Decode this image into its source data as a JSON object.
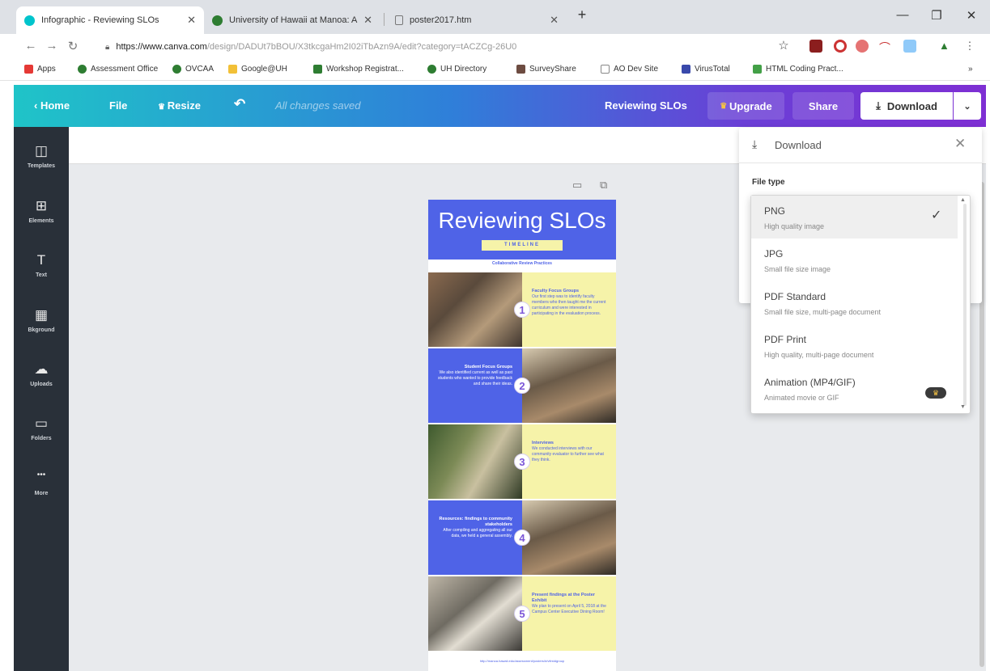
{
  "browser": {
    "tabs": [
      {
        "title": "Infographic - Reviewing SLOs",
        "active": true,
        "color": "#00c4cc"
      },
      {
        "title": "University of Hawaii at Manoa: A",
        "active": false,
        "color": "#2e7d32"
      },
      {
        "title": "poster2017.htm",
        "active": false,
        "color": "#9e9e9e"
      }
    ],
    "new_tab": "+",
    "url_host": "https://www.canva.com",
    "url_path": "/design/DADUt7bBOU/X3tkcgaHm2I02iTbAzn9A/edit?category=tACZCg-26U0",
    "bookmarks": [
      {
        "label": "Apps",
        "color": "#e53935"
      },
      {
        "label": "Assessment Office",
        "color": "#2e7d32"
      },
      {
        "label": "OVCAA",
        "color": "#2e7d32"
      },
      {
        "label": "Google@UH",
        "color": "#f2c037"
      },
      {
        "label": "Workshop Registrat...",
        "color": "#2e7d32"
      },
      {
        "label": "UH Directory",
        "color": "#2e7d32"
      },
      {
        "label": "SurveyShare",
        "color": "#6d4c41"
      },
      {
        "label": "AO Dev Site",
        "color": "#9e9e9e"
      },
      {
        "label": "VirusTotal",
        "color": "#3949ab"
      },
      {
        "label": "HTML Coding Pract...",
        "color": "#43a047"
      }
    ],
    "bookmarks_more": "»"
  },
  "toolbar": {
    "home": "Home",
    "file": "File",
    "resize": "Resize",
    "saved_status": "All changes saved",
    "design_title": "Reviewing SLOs",
    "upgrade": "Upgrade",
    "share": "Share",
    "download": "Download"
  },
  "sidebar": {
    "items": [
      {
        "label": "Templates",
        "icon": "templates-icon",
        "glyph": "◫"
      },
      {
        "label": "Elements",
        "icon": "elements-icon",
        "glyph": "⊞"
      },
      {
        "label": "Text",
        "icon": "text-icon",
        "glyph": "T"
      },
      {
        "label": "Bkground",
        "icon": "background-icon",
        "glyph": "▦"
      },
      {
        "label": "Uploads",
        "icon": "upload-cloud-icon",
        "glyph": "☁"
      },
      {
        "label": "Folders",
        "icon": "folder-icon",
        "glyph": "▭"
      },
      {
        "label": "More",
        "icon": "more-icon",
        "glyph": "•••"
      }
    ]
  },
  "poster": {
    "title": "Reviewing SLOs",
    "badge": "TIMELINE",
    "subtitle": "Collaborative Review Practices",
    "steps": [
      {
        "num": "1",
        "heading": "Faculty Focus Groups",
        "text": "Our first step was to identify faculty members who then taught me the current curriculum and were interested in participating in the evaluation process."
      },
      {
        "num": "2",
        "heading": "Student Focus Groups",
        "text": "We also identified current as well as past students who wanted to provide feedback and share their ideas."
      },
      {
        "num": "3",
        "heading": "Interviews",
        "text": "We conducted interviews with our community evaluator to further see what they think."
      },
      {
        "num": "4",
        "heading": "Resources: findings to community stakeholders",
        "text": "After compiling and aggregating all our data, we held a general assembly."
      },
      {
        "num": "5",
        "heading": "Present findings at the Poster Exhibit",
        "text": "We plan to present on April 5, 2018 at the Campus Center Executive Dining Room!"
      }
    ],
    "url": "http://manoa.hawaii.edu/assessment/posters/#/vfirstdgroup"
  },
  "download_panel": {
    "title": "Download",
    "file_type_label": "File type",
    "options": [
      {
        "name": "PNG",
        "desc": "High quality image",
        "selected": true
      },
      {
        "name": "JPG",
        "desc": "Small file size image",
        "selected": false
      },
      {
        "name": "PDF Standard",
        "desc": "Small file size, multi-page document",
        "selected": false
      },
      {
        "name": "PDF Print",
        "desc": "High quality, multi-page document",
        "selected": false
      },
      {
        "name": "Animation (MP4/GIF)",
        "desc": "Animated movie or GIF",
        "selected": false,
        "premium": true
      }
    ]
  }
}
